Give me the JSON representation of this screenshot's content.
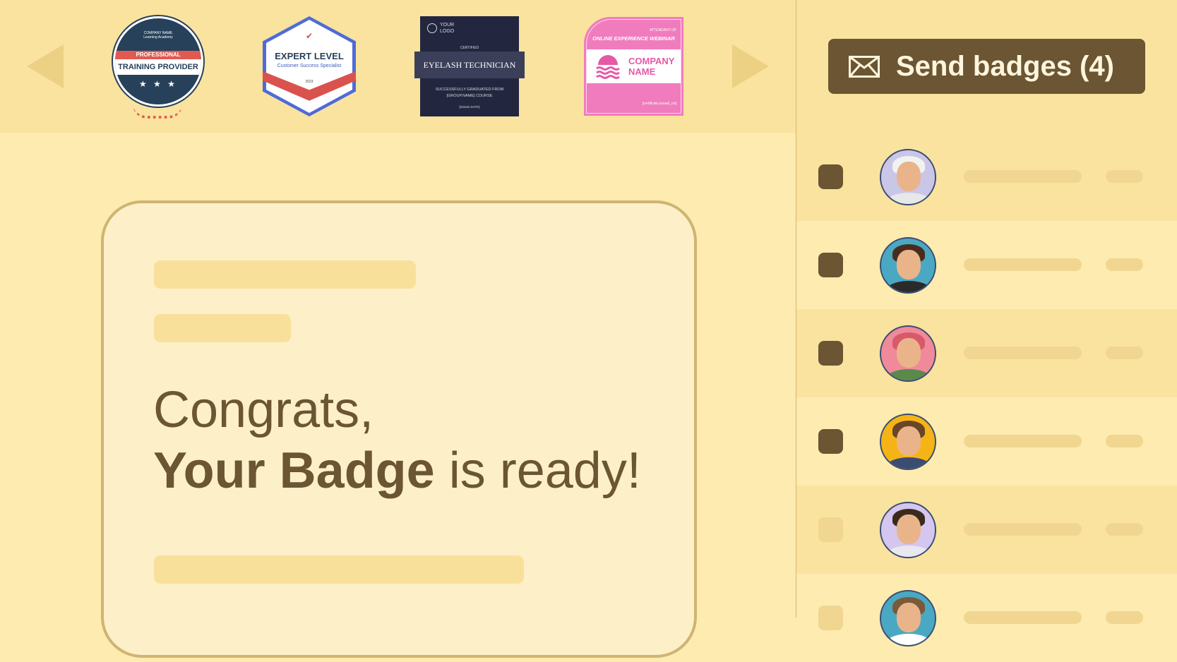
{
  "carousel": {
    "prev_icon": "triangle-left-icon",
    "next_icon": "triangle-right-icon",
    "badges": [
      {
        "kind": "round",
        "top_line_1": "COMPANY NAME",
        "top_line_2": "Learning Academy",
        "ribbon": "PROFESSIONAL",
        "title": "TRAINING PROVIDER",
        "stars": "★ ★ ★"
      },
      {
        "kind": "hexagon",
        "title": "EXPERT LEVEL",
        "subtitle": "Customer Success Specialist",
        "year": "2023"
      },
      {
        "kind": "certificate",
        "logo_line_1": "YOUR",
        "logo_line_2": "LOGO",
        "certified": "CERTIFIED",
        "title": "EYELASH TECHNICIAN",
        "grad_line_1": "SUCCESSFULLY GRADUATED FROM",
        "grad_line_2": "[GROUP.NAME] COURSE",
        "date": "[ISSUE.DATE]"
      },
      {
        "kind": "pink",
        "attendant": "ATTENDANT OF",
        "webinar": "ONLINE EXPERIENCE WEBINAR",
        "company_line_1": "COMPANY",
        "company_line_2": "NAME",
        "footer": "[certificate.issued_on]"
      }
    ]
  },
  "send_button": {
    "icon": "mail-icon",
    "label": "Send badges (4)"
  },
  "recipients": [
    {
      "checked": true,
      "hair": "#f2f2f2",
      "bg": "#c9c6e8",
      "shirt": "#e8e8e8"
    },
    {
      "checked": true,
      "hair": "#4a2c1f",
      "bg": "#4aa8c2",
      "shirt": "#2a2a2a"
    },
    {
      "checked": true,
      "hair": "#d75a6a",
      "bg": "#f0899a",
      "shirt": "#5a8a4a"
    },
    {
      "checked": true,
      "hair": "#6a4528",
      "bg": "#f5b416",
      "shirt": "#3b4c73"
    },
    {
      "checked": false,
      "hair": "#3a2a1e",
      "bg": "#d4c6ee",
      "shirt": "#e8e8f0"
    },
    {
      "checked": false,
      "hair": "#7a5a3a",
      "bg": "#4aa8c2",
      "shirt": "#ffffff"
    }
  ],
  "email": {
    "line1": "Congrats,",
    "bold": "Your Badge",
    "rest": " is ready!"
  }
}
